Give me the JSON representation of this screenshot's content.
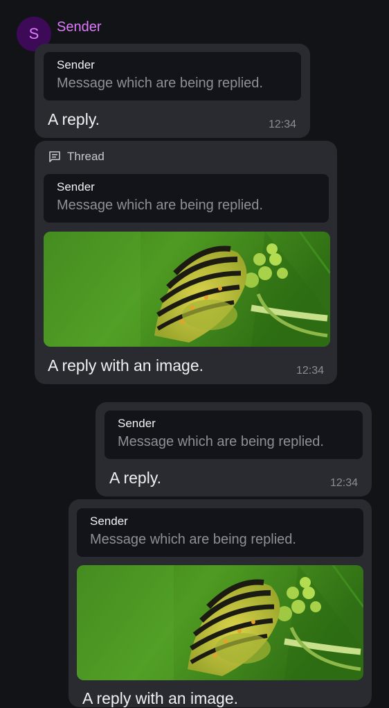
{
  "sender": {
    "initial": "S",
    "name": "Sender"
  },
  "messages": [
    {
      "reply_sender": "Sender",
      "reply_text": "Message which are being replied.",
      "text": "A reply.",
      "time": "12:34"
    },
    {
      "thread_label": "Thread",
      "reply_sender": "Sender",
      "reply_text": "Message which are being replied.",
      "text": "A reply with an image.",
      "time": "12:34",
      "image": "caterpillar-photo"
    },
    {
      "reply_sender": "Sender",
      "reply_text": "Message which are being replied.",
      "text": "A reply.",
      "time": "12:34"
    },
    {
      "reply_sender": "Sender",
      "reply_text": "Message which are being replied.",
      "text": "A reply with an image.",
      "image": "caterpillar-photo"
    }
  ],
  "colors": {
    "background": "#111317",
    "bubble": "#2a2b30",
    "reply_box": "#131419",
    "sender_accent": "#e07bff",
    "avatar_bg": "#3d0a57"
  }
}
